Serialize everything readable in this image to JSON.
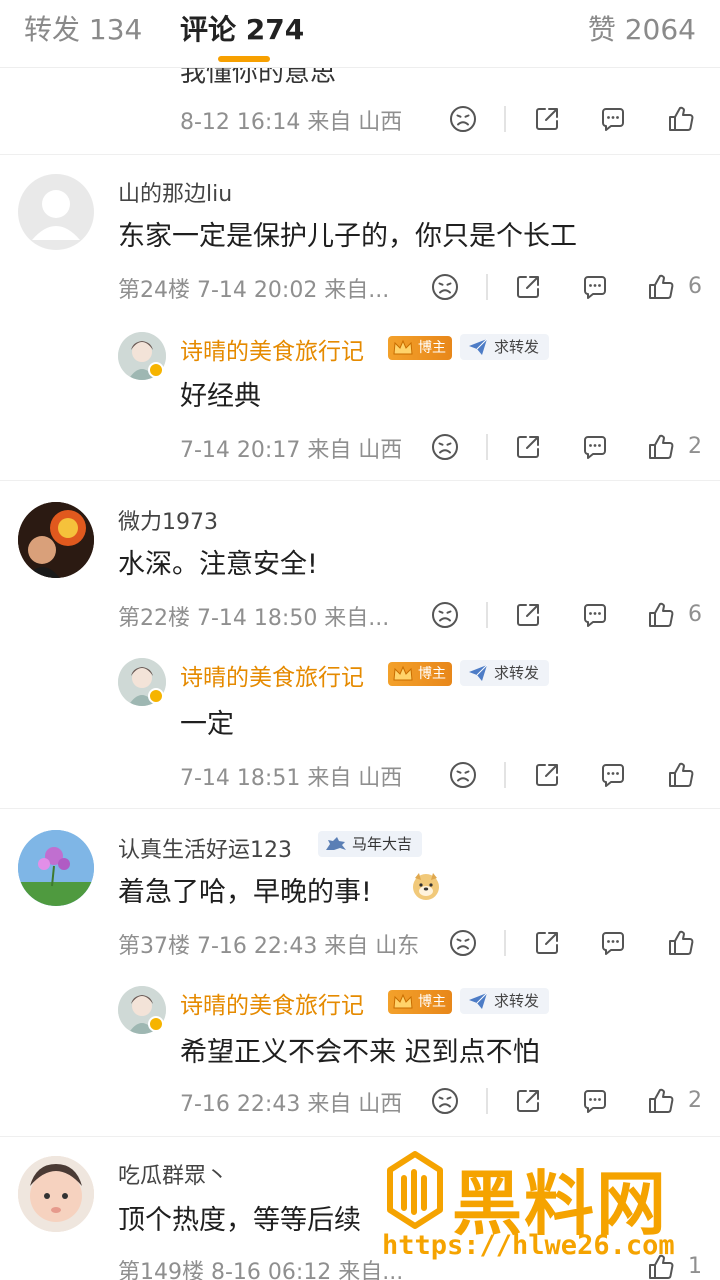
{
  "tabs": {
    "repost": "转发 134",
    "comments": "评论 274",
    "likes": "赞 2064"
  },
  "partial_comment": {
    "cut_text": "我懂你的意思",
    "meta": "8-12 16:14  来自 山西"
  },
  "comments": [
    {
      "username": "山的那边liu",
      "text": "东家一定是保护儿子的，你只是个长工",
      "meta": "第24楼  7-14 20:02  来自...",
      "like_count": "6",
      "reply": {
        "username": "诗晴的美食旅行记",
        "badge_boss": "博主",
        "badge_fwd": "求转发",
        "text": "好经典",
        "meta": "7-14 20:17  来自 山西",
        "like_count": "2"
      }
    },
    {
      "username": "微力1973",
      "text": "水深。注意安全!",
      "meta": "第22楼  7-14 18:50  来自...",
      "like_count": "6",
      "reply": {
        "username": "诗晴的美食旅行记",
        "badge_boss": "博主",
        "badge_fwd": "求转发",
        "text": "一定",
        "meta": "7-14 18:51  来自 山西",
        "like_count": ""
      }
    },
    {
      "username": "认真生活好运123",
      "badge": "马年大吉",
      "text": "着急了哈，早晚的事!",
      "meta": "第37楼  7-16 22:43  来自 山东",
      "like_count": "",
      "reply": {
        "username": "诗晴的美食旅行记",
        "badge_boss": "博主",
        "badge_fwd": "求转发",
        "text": "希望正义不会不来 迟到点不怕",
        "meta": "7-16 22:43  来自 山西",
        "like_count": "2"
      }
    },
    {
      "username": "吃瓜群眾丶",
      "text": "顶个热度，等等后续",
      "meta": "第149楼  8-16 06:12  来自...",
      "like_count": "1"
    }
  ],
  "watermark": {
    "title": "黑料网",
    "url": "https://hlwe26.com"
  },
  "icons": [
    "dislike-icon",
    "share-icon",
    "comment-icon",
    "like-icon"
  ],
  "colors": {
    "accent": "#f7a000",
    "reply_name": "#e58a00",
    "meta": "#8f8f8f"
  }
}
